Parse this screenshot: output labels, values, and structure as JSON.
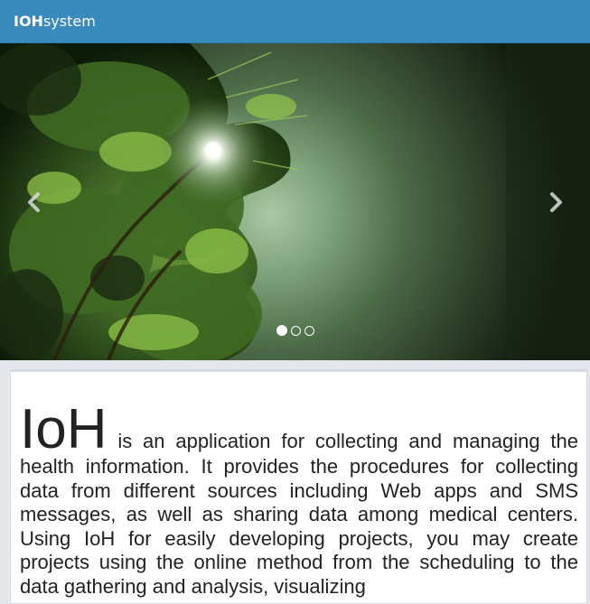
{
  "navbar": {
    "brand_bold": "IOH",
    "brand_light": "system",
    "color": "#3a8bbd"
  },
  "carousel": {
    "prev_icon": "chevron-left-icon",
    "next_icon": "chevron-right-icon",
    "slide_count": 3,
    "active_slide": 1
  },
  "intro": {
    "lead": "IoH",
    "text": " is an application for collecting and managing the health information. It provides the procedures for collecting data from different sources including Web apps and SMS messages, as well as sharing data among medical centers. Using IoH for easily developing projects, you may create projects using the online method from the scheduling to the data gathering and analysis, visualizing"
  }
}
